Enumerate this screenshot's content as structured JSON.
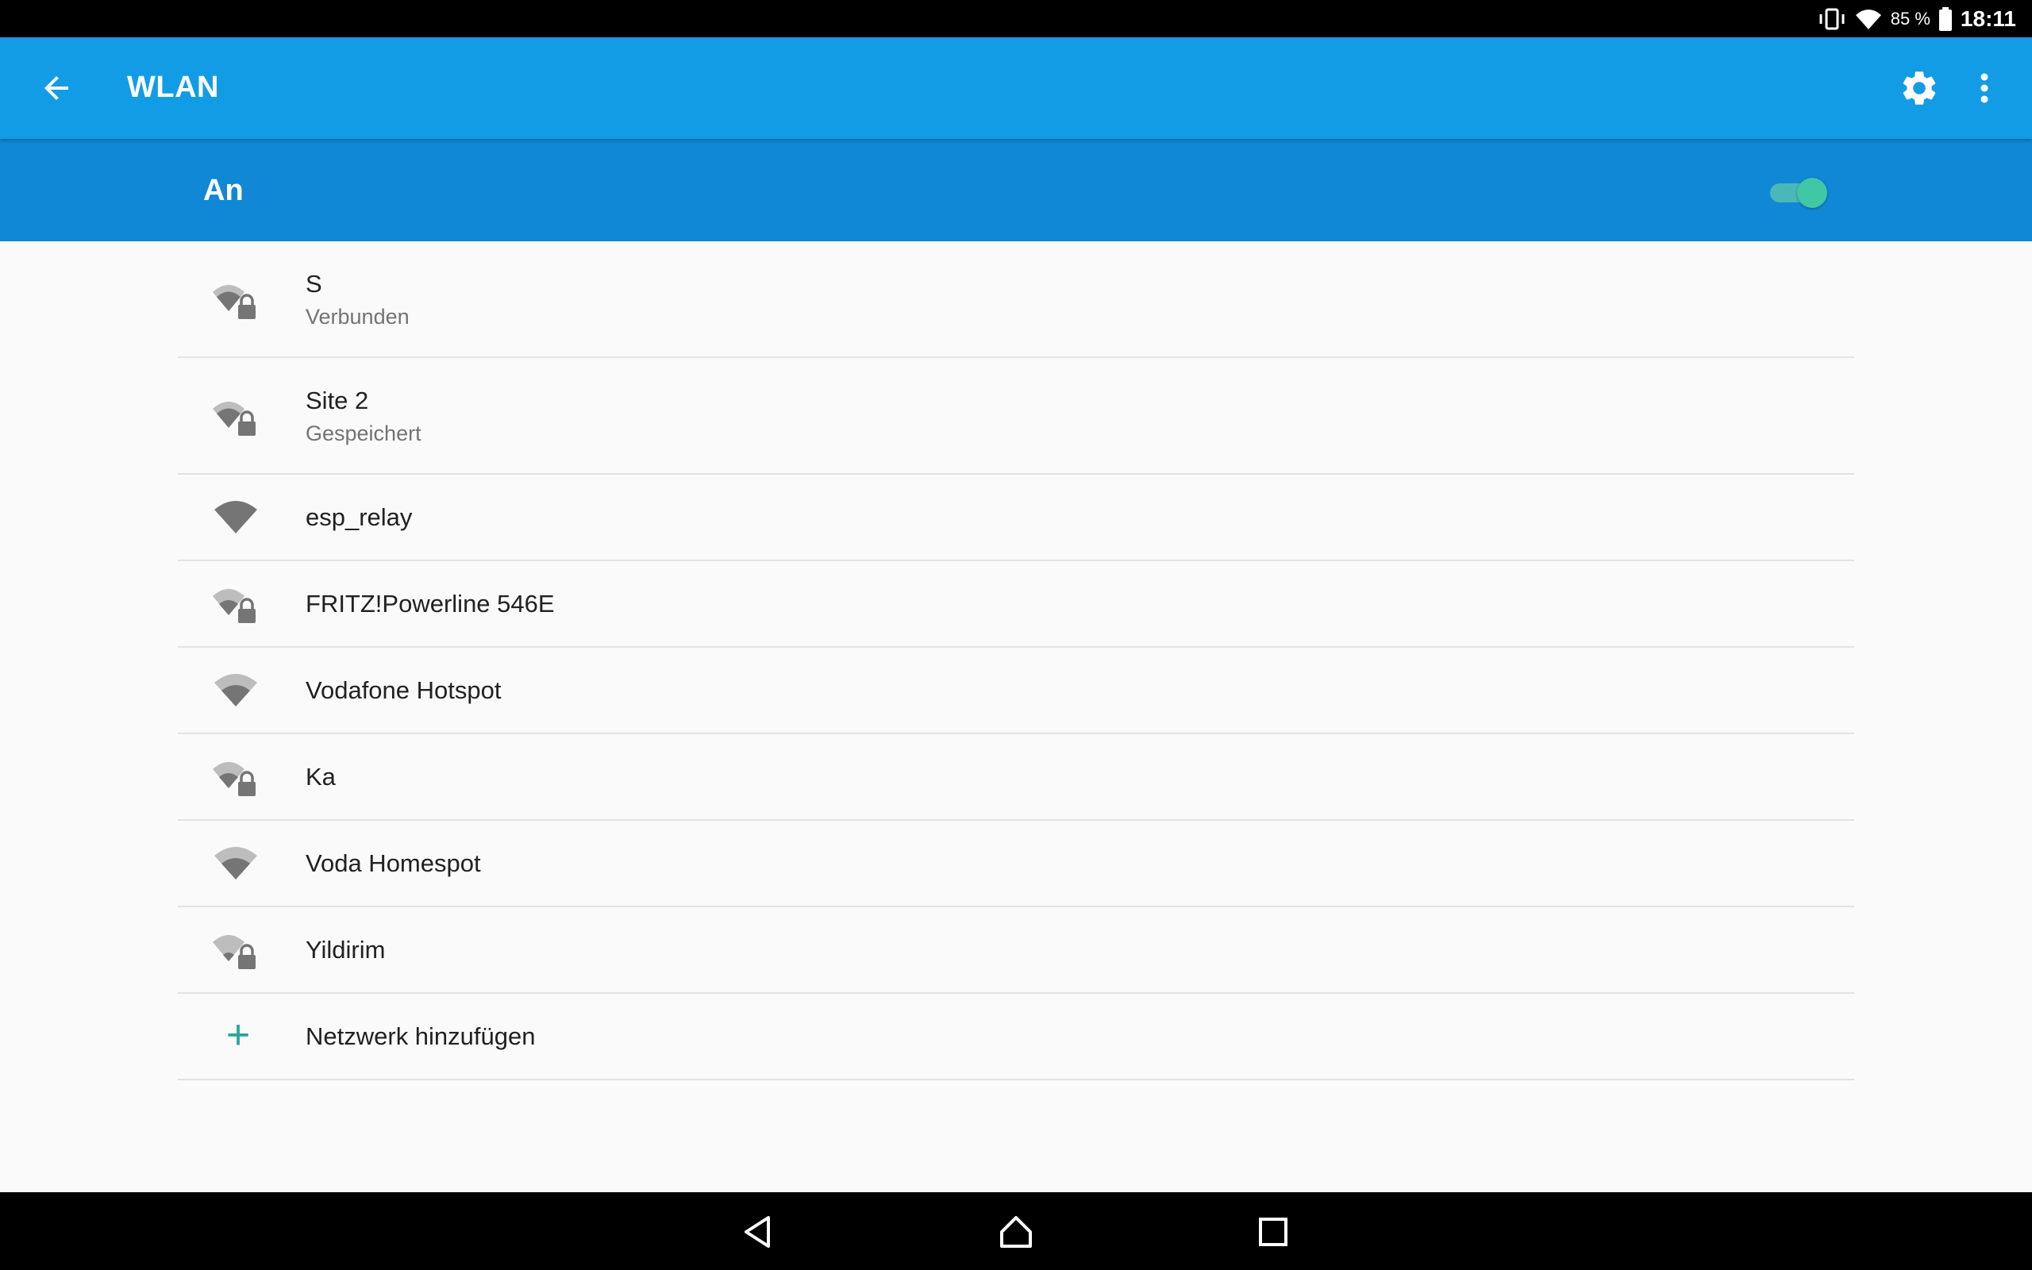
{
  "status_bar": {
    "battery_percent": "85 %",
    "time": "18:11",
    "icons": [
      "vibrate-icon",
      "wifi-icon",
      "battery-icon"
    ]
  },
  "app_bar": {
    "title": "WLAN",
    "icons": [
      "back-arrow-icon",
      "gear-icon",
      "more-vert-icon"
    ]
  },
  "master_switch": {
    "label": "An",
    "state": "on",
    "accent_color": "#3fc7a6"
  },
  "networks": [
    {
      "name": "S",
      "status": "Verbunden",
      "secured": true,
      "signal": 3
    },
    {
      "name": "Site 2",
      "status": "Gespeichert",
      "secured": true,
      "signal": 3
    },
    {
      "name": "esp_relay",
      "status": "",
      "secured": false,
      "signal": 4
    },
    {
      "name": "FRITZ!Powerline 546E",
      "status": "",
      "secured": true,
      "signal": 2
    },
    {
      "name": "Vodafone Hotspot",
      "status": "",
      "secured": false,
      "signal": 2
    },
    {
      "name": "Ka",
      "status": "",
      "secured": true,
      "signal": 2
    },
    {
      "name": "Voda Homespot",
      "status": "",
      "secured": false,
      "signal": 2
    },
    {
      "name": "Yildirim",
      "status": "",
      "secured": true,
      "signal": 1
    }
  ],
  "add_network": {
    "label": "Netzwerk hinzufügen",
    "icon": "plus-icon"
  },
  "colors": {
    "app_bar": "#139ce6",
    "switch_bar": "#1188d6",
    "accent": "#26a69a"
  }
}
